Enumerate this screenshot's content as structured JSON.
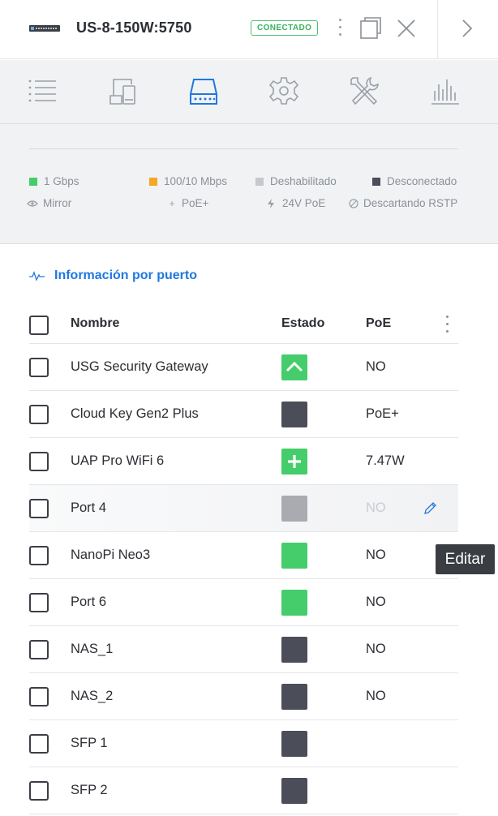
{
  "header": {
    "device_name": "US-8-150W:5750",
    "status": "CONECTADO",
    "icons": [
      "kebab-icon",
      "window-icon",
      "close-icon",
      "chevron-right-icon"
    ]
  },
  "tabs": [
    "list-icon",
    "devices-icon",
    "ports-icon",
    "settings-icon",
    "tools-icon",
    "stats-icon"
  ],
  "active_tab": "ports-icon",
  "legend": {
    "gbps": "1 Gbps",
    "mbps": "100/10 Mbps",
    "disabled": "Deshabilitado",
    "disconnected": "Desconectado",
    "mirror": "Mirror",
    "poe_plus": "PoE+",
    "poe_24v": "24V PoE",
    "rstp": "Descartando RSTP",
    "colors": {
      "gbps": "#44cd6a",
      "mbps": "#f5a623",
      "disabled": "#c6c8cc",
      "disconnected": "#4b4e58"
    }
  },
  "section": {
    "title": "Información por puerto"
  },
  "table": {
    "headers": {
      "name": "Nombre",
      "state": "Estado",
      "poe": "PoE"
    },
    "rows": [
      {
        "name": "USG Security Gateway",
        "poe": "NO"
      },
      {
        "name": "Cloud Key Gen2 Plus",
        "poe": "PoE+"
      },
      {
        "name": "UAP Pro WiFi 6",
        "poe": "7.47W"
      },
      {
        "name": "Port 4",
        "poe": "NO"
      },
      {
        "name": "NanoPi Neo3",
        "poe": "NO"
      },
      {
        "name": "Port 6",
        "poe": "NO"
      },
      {
        "name": "NAS_1",
        "poe": "NO"
      },
      {
        "name": "NAS_2",
        "poe": "NO"
      },
      {
        "name": "SFP 1",
        "poe": ""
      },
      {
        "name": "SFP 2",
        "poe": ""
      }
    ]
  },
  "tooltip": "Editar"
}
